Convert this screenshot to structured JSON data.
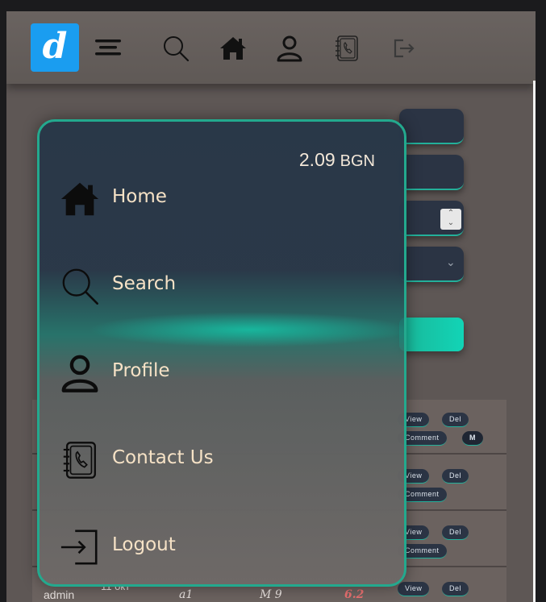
{
  "header": {
    "logo_letter": "d",
    "icons": [
      "menu-icon",
      "search-icon",
      "home-icon",
      "user-icon",
      "contact-book-icon",
      "logout-icon"
    ]
  },
  "menu": {
    "balance_value": "2.09",
    "balance_currency": "BGN",
    "items": [
      {
        "label": "Home",
        "icon": "home-icon"
      },
      {
        "label": "Search",
        "icon": "search-icon"
      },
      {
        "label": "Profile",
        "icon": "user-icon"
      },
      {
        "label": "Contact Us",
        "icon": "contact-book-icon"
      },
      {
        "label": "Logout",
        "icon": "logout-icon"
      }
    ]
  },
  "table": {
    "actions": {
      "view": "View",
      "del": "Del",
      "comment": "Comment",
      "m": "M"
    },
    "last_row": {
      "user": "admin",
      "date": "11 окт",
      "a": "a1",
      "b": "M 9",
      "score": "6.2"
    }
  },
  "colors": {
    "accent": "#23a98e",
    "brand": "#1a9df0",
    "panel": "#2b3444",
    "text": "#f6e2c6"
  }
}
